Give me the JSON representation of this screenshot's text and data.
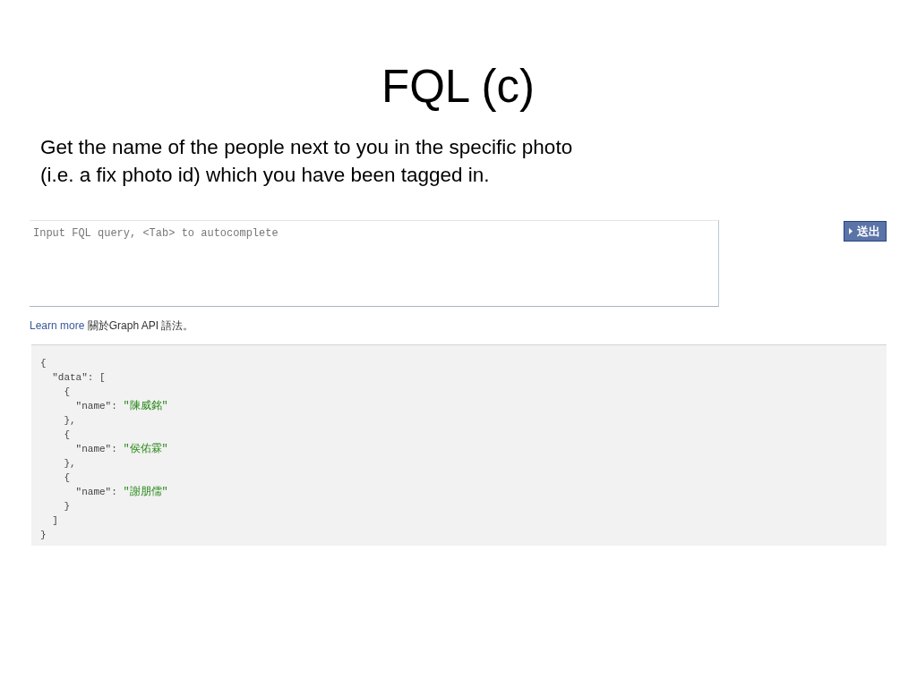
{
  "title": "FQL (c)",
  "description": "Get the name of the people next to you in the specific photo\n(i.e. a fix photo id) which you have been tagged in.",
  "query": {
    "placeholder": "Input FQL query, <Tab> to autocomplete"
  },
  "submit_button": {
    "label": "送出"
  },
  "help": {
    "link": "Learn more",
    "text": "關於Graph API 語法。"
  },
  "result": {
    "lines": [
      {
        "text": "{"
      },
      {
        "text": "  \"data\": ["
      },
      {
        "text": "    {"
      },
      {
        "text": "      \"name\": ",
        "value": "\"陳威銘\""
      },
      {
        "text": "    },"
      },
      {
        "text": "    {"
      },
      {
        "text": "      \"name\": ",
        "value": "\"侯佑霖\""
      },
      {
        "text": "    },"
      },
      {
        "text": "    {"
      },
      {
        "text": "      \"name\": ",
        "value": "\"謝朋儒\""
      },
      {
        "text": "    }"
      },
      {
        "text": "  ]"
      },
      {
        "text": "}"
      }
    ]
  }
}
